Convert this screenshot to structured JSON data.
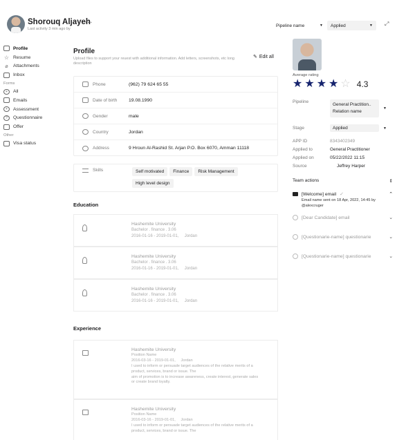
{
  "header": {
    "name": "Shorouq Aljayeh",
    "more": "...",
    "last_activity": "Last activity 3 min ago by",
    "pipeline_label": "Pipeline name",
    "stage_label": "Applied"
  },
  "sidebar": {
    "items": [
      "Profile",
      "Resume",
      "Attachments",
      "Inbox"
    ],
    "forms_label": "Forms",
    "form_items": [
      "All",
      "Emails",
      "Assessment",
      "Questionnaire",
      "Offer"
    ],
    "other_label": "Other",
    "other_items": [
      "Visa status"
    ]
  },
  "profile": {
    "title": "Profile",
    "description": "Upload files to support your reuest with additional information. Add letters, screenshots, etc long description",
    "edit_all": "Edit all",
    "fields": [
      {
        "label": "Phone",
        "value": "(962) 79 624 65 55"
      },
      {
        "label": "Date of birth",
        "value": "19.08.1990"
      },
      {
        "label": "Gender",
        "value": "male"
      },
      {
        "label": "Country",
        "value": "Jordan"
      },
      {
        "label": "Address",
        "value": "9 Hroun Al-Rashid St. Arjan P.O. Box 6070, Amman 11118"
      }
    ],
    "skills_label": "Skills",
    "skills": [
      "Self motivated",
      "Finance",
      "Risk Management",
      "High level design"
    ]
  },
  "education": {
    "title": "Education",
    "items": [
      {
        "school": "Hashemite University",
        "degree": "Bachelor . finance . 3.06",
        "dates": "2016-01-16 - 2019-01-01,",
        "location": "Jordan"
      },
      {
        "school": "Hashemite University",
        "degree": "Bachelor . finance . 3.06",
        "dates": "2016-01-16 - 2019-01-01,",
        "location": "Jordan"
      },
      {
        "school": "Hashemite University",
        "degree": "Bachelor . finance . 3.06",
        "dates": "2016-01-16 - 2019-01-01,",
        "location": "Jordan"
      }
    ]
  },
  "experience": {
    "title": "Experience",
    "items": [
      {
        "company": "Hashemite University",
        "position": "Position Name",
        "dates": "2016-03-16 - 2019-01-01,",
        "location": "Jordan",
        "line1": "I used to inform or persuade target audiences of the relative merits of a",
        "line2": "product, services, brand or issue. The",
        "line3": "aim of promotion is to increase awareness, create interest, generate sales",
        "line4": "or create brand loyalty."
      },
      {
        "company": "Hashemite University",
        "position": "Position Name",
        "dates": "2016-03-16 - 2019-01-01,",
        "location": "Jordan",
        "line1": "I used to inform or persuade target audiences of the relative merits of a",
        "line2": "product, services, brand or issue. The"
      }
    ]
  },
  "right": {
    "avg_rating_label": "Average rating",
    "rating": 4.3,
    "rating_text": "4.3",
    "pipeline_label": "Pipeline",
    "pipeline_value1": "General Practition..",
    "pipeline_value2": "Relation name",
    "stage_label": "Stage",
    "stage_value": "Applied",
    "app_id_label": "APP ID",
    "app_id_value": "8343402349",
    "applied_to_label": "Applied to",
    "applied_to_value": "General Practitioner",
    "applied_on_label": "Applied on",
    "applied_on_value": "05/22/2022 11:15",
    "source_label": "Source",
    "source_value": "Jeffrey Harper",
    "team_actions_label": "Team actions",
    "actions": [
      {
        "label": "[Welcome] email",
        "detail1": "Email name sent on 18 Apr, 2022, 14:45 by",
        "detail2": "@alexcruger"
      },
      {
        "label": "[Dear Candidate] email"
      },
      {
        "label": "[Questionarie-name] questionarie"
      },
      {
        "label": "[Questionarie-name] questionarie"
      }
    ]
  },
  "colors": {
    "star": "#16246e",
    "chip_bg": "#f2f2f2",
    "border": "#ececec"
  }
}
